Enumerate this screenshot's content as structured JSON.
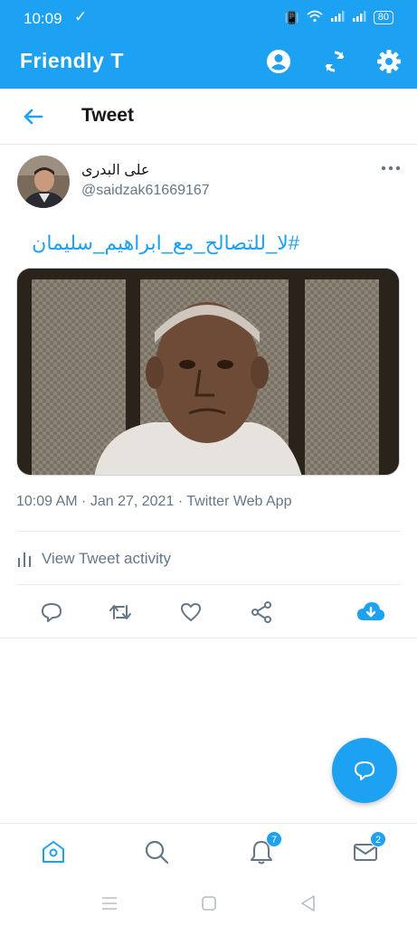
{
  "status_bar": {
    "time": "10:09",
    "check": "✓",
    "battery": "80"
  },
  "app_bar": {
    "title": "Friendly T"
  },
  "header": {
    "title": "Tweet"
  },
  "tweet": {
    "author_name": "على البدرى",
    "author_handle": "@saidzak61669167",
    "text": "#لا_للتصالح_مع_ابراهيم_سليمان",
    "meta": "10:09 AM · Jan 27, 2021 · Twitter Web App",
    "activity_label": "View Tweet activity"
  },
  "bottom_nav": {
    "notifications_badge": "7",
    "messages_badge": "2"
  },
  "colors": {
    "brand": "#1da1f2",
    "muted": "#657786"
  }
}
